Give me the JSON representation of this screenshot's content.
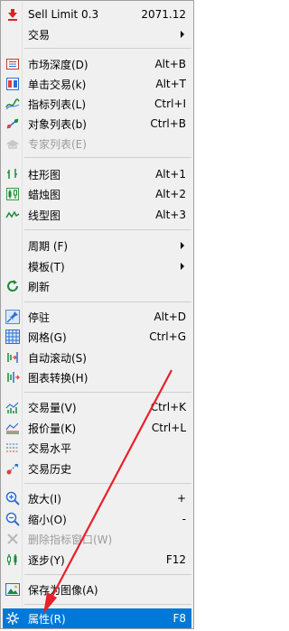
{
  "menu": {
    "sell_limit": {
      "label": "Sell Limit 0.3",
      "value": "2071.12"
    },
    "trade": {
      "label": "交易"
    },
    "depth": {
      "label": "市场深度(D)",
      "shortcut": "Alt+B"
    },
    "one_click": {
      "label": "单击交易(k)",
      "shortcut": "Alt+T"
    },
    "indicators": {
      "label": "指标列表(L)",
      "shortcut": "Ctrl+I"
    },
    "objects": {
      "label": "对象列表(b)",
      "shortcut": "Ctrl+B"
    },
    "experts": {
      "label": "专家列表(E)"
    },
    "bar_chart": {
      "label": "柱形图",
      "shortcut": "Alt+1"
    },
    "candle_chart": {
      "label": "蜡烛图",
      "shortcut": "Alt+2"
    },
    "line_chart": {
      "label": "线型图",
      "shortcut": "Alt+3"
    },
    "period": {
      "label": "周期 (F)"
    },
    "template": {
      "label": "模板(T)"
    },
    "refresh": {
      "label": "刷新"
    },
    "dock": {
      "label": "停驻",
      "shortcut": "Alt+D"
    },
    "grid": {
      "label": "网格(G)",
      "shortcut": "Ctrl+G"
    },
    "autoscroll": {
      "label": "自动滚动(S)"
    },
    "chart_shift": {
      "label": "图表转换(H)"
    },
    "volume": {
      "label": "交易量(V)",
      "shortcut": "Ctrl+K"
    },
    "ask_line": {
      "label": "报价量(K)",
      "shortcut": "Ctrl+L"
    },
    "trade_levels": {
      "label": "交易水平"
    },
    "trade_history": {
      "label": "交易历史"
    },
    "zoom_in": {
      "label": "放大(I)",
      "shortcut": "+"
    },
    "zoom_out": {
      "label": "缩小(O)",
      "shortcut": "-"
    },
    "delete_indicator": {
      "label": "删除指标窗口(W)"
    },
    "step": {
      "label": "逐步(Y)",
      "shortcut": "F12"
    },
    "save_image": {
      "label": "保存为图像(A)"
    },
    "properties": {
      "label": "属性(R)",
      "shortcut": "F8"
    }
  },
  "colors": {
    "highlight": "#0078d7",
    "annotation_arrow": "#e8202a"
  }
}
